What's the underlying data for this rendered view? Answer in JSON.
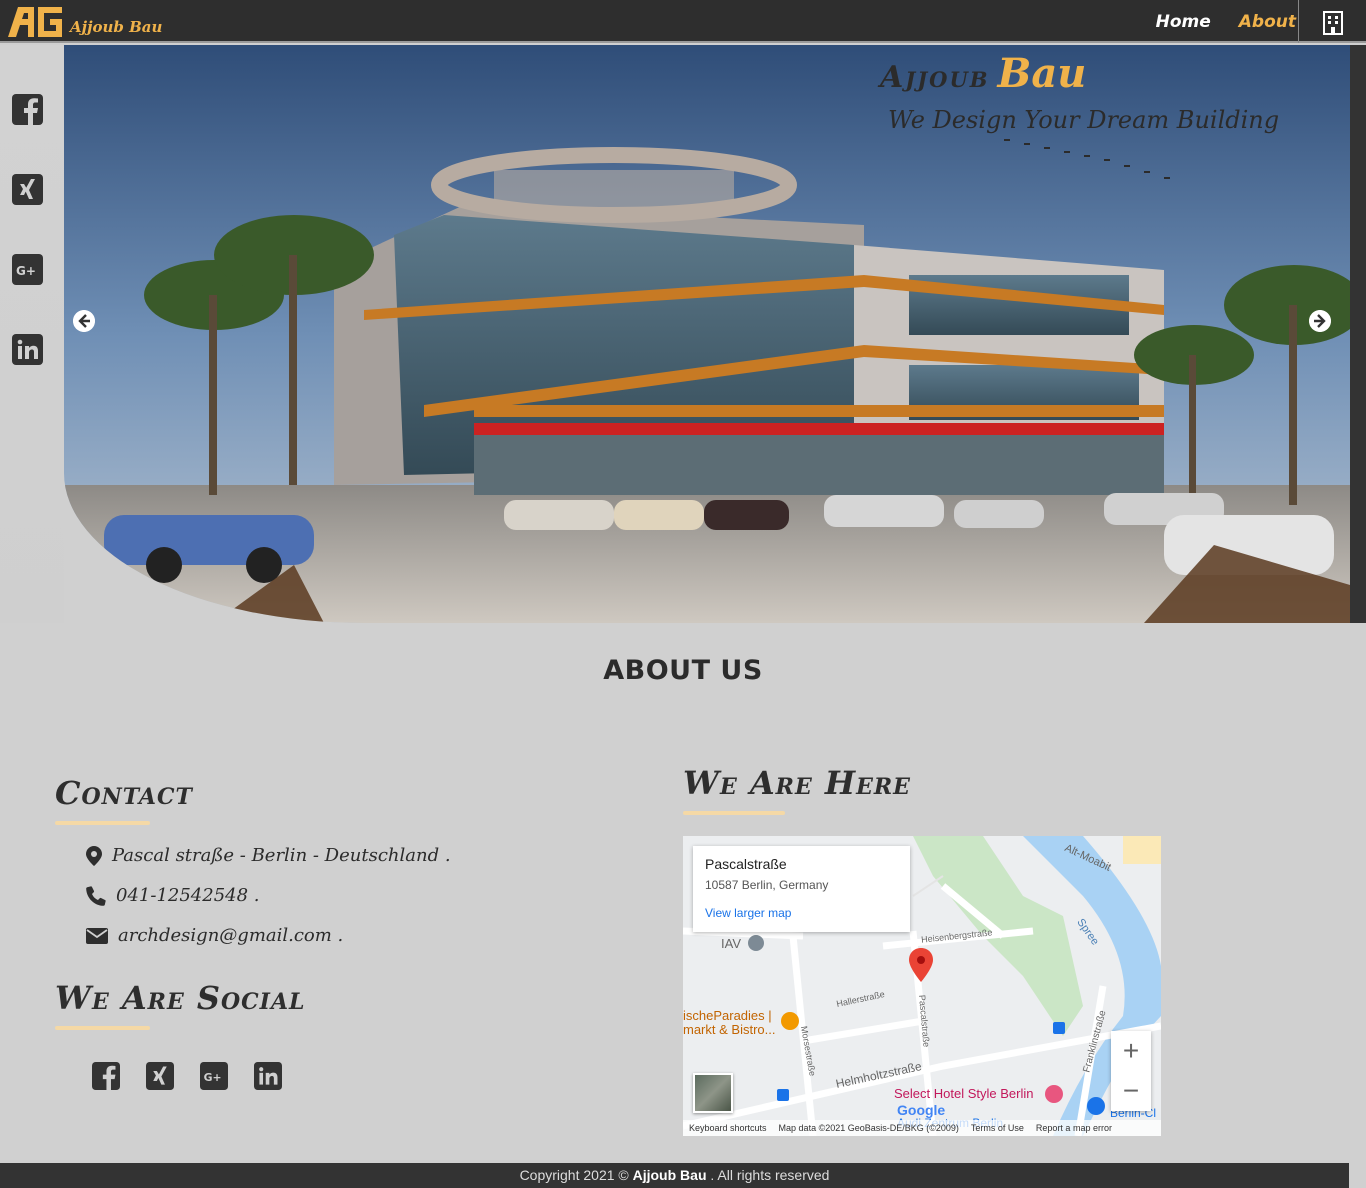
{
  "header": {
    "logo_text": "Ajjoub Bau",
    "nav": {
      "home": "Home",
      "about": "About"
    }
  },
  "hero": {
    "title_part1": "Ajjoub",
    "title_part2": "Bau",
    "subtitle": "We Design Your Dream Building"
  },
  "about": {
    "title": "ABOUT US",
    "contact_heading": "Contact",
    "contact": {
      "address": "Pascal straße - Berlin - Deutschland .",
      "phone": "041-12542548 .",
      "email": "archdesign@gmail.com ."
    },
    "social_heading": "We Are Social",
    "here_heading": "We Are Here"
  },
  "map": {
    "place_name": "Pascalstraße",
    "place_address": "10587 Berlin, Germany",
    "view_larger": "View larger map",
    "labels": {
      "iav": "IAV",
      "alt_moabit": "Alt-Moabit",
      "spree": "Spree",
      "heisenberg": "Heisenbergstraße",
      "haller": "Hallerstraße",
      "pascal": "Pascalstraße",
      "morse": "Morsestraße",
      "helmholtz": "Helmholtzstraße",
      "franklin": "Franklinstraße",
      "hotel": "Select Hotel Style Berlin",
      "paradies": "ischeParadies |",
      "bistro": "markt & Bistro...",
      "audi": "Audi Zentrum Berlin",
      "berlin_cl": "Berlin-Cl"
    },
    "footer": {
      "keyboard": "Keyboard shortcuts",
      "data": "Map data ©2021 GeoBasis-DE/BKG (©2009)",
      "terms": "Terms of Use",
      "report": "Report a map error"
    },
    "google": "Google",
    "zoom_in": "+",
    "zoom_out": "−"
  },
  "footer": {
    "prefix": "Copyright 2021 © ",
    "brand": "Ajjoub Bau",
    "suffix": " . All rights reserved"
  },
  "colors": {
    "accent": "#f0b24a",
    "dark": "#2e2e2e",
    "bg": "#d0d0d0"
  }
}
